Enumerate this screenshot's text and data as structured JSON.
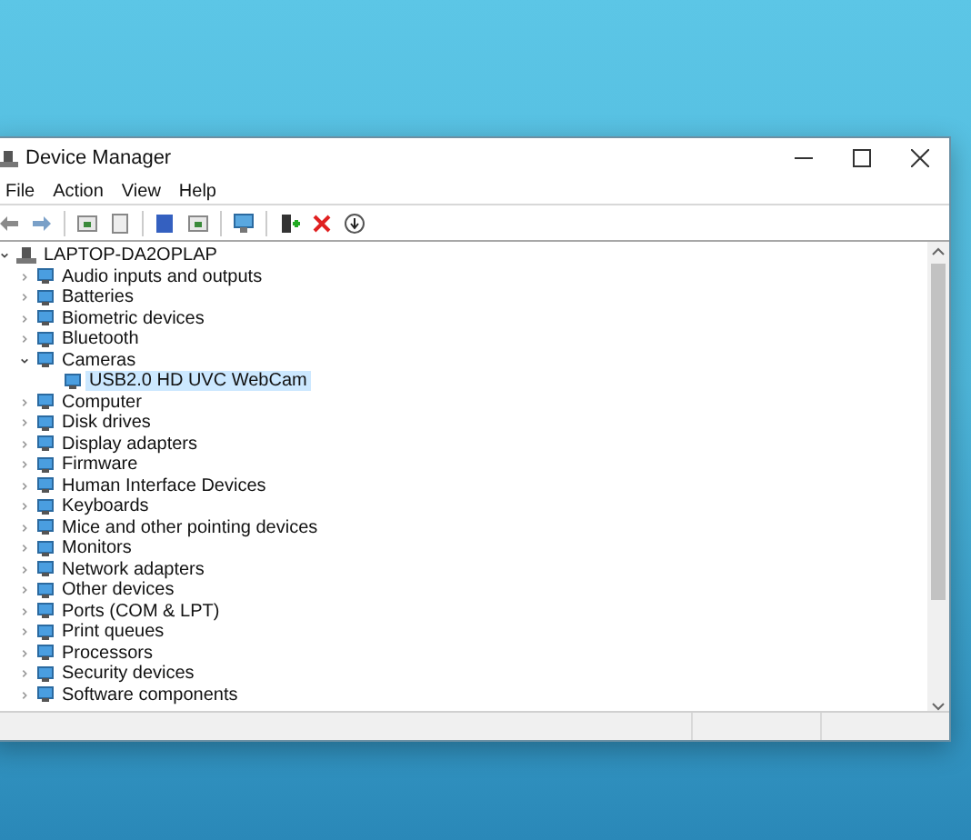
{
  "window": {
    "title": "Device Manager"
  },
  "menu": [
    "File",
    "Action",
    "View",
    "Help"
  ],
  "tree": {
    "label": "LAPTOP-DA2OPLAP",
    "expanded": true,
    "selected": false,
    "children": [
      {
        "label": "Audio inputs and outputs",
        "expanded": false,
        "selected": false
      },
      {
        "label": "Batteries",
        "expanded": false,
        "selected": false
      },
      {
        "label": "Biometric devices",
        "expanded": false,
        "selected": false
      },
      {
        "label": "Bluetooth",
        "expanded": false,
        "selected": false
      },
      {
        "label": "Cameras",
        "expanded": true,
        "selected": false,
        "children": [
          {
            "label": "USB2.0 HD UVC WebCam",
            "selected": true
          }
        ]
      },
      {
        "label": "Computer",
        "expanded": false,
        "selected": false
      },
      {
        "label": "Disk drives",
        "expanded": false,
        "selected": false
      },
      {
        "label": "Display adapters",
        "expanded": false,
        "selected": false
      },
      {
        "label": "Firmware",
        "expanded": false,
        "selected": false
      },
      {
        "label": "Human Interface Devices",
        "expanded": false,
        "selected": false
      },
      {
        "label": "Keyboards",
        "expanded": false,
        "selected": false
      },
      {
        "label": "Mice and other pointing devices",
        "expanded": false,
        "selected": false
      },
      {
        "label": "Monitors",
        "expanded": false,
        "selected": false
      },
      {
        "label": "Network adapters",
        "expanded": false,
        "selected": false
      },
      {
        "label": "Other devices",
        "expanded": false,
        "selected": false
      },
      {
        "label": "Ports (COM & LPT)",
        "expanded": false,
        "selected": false
      },
      {
        "label": "Print queues",
        "expanded": false,
        "selected": false
      },
      {
        "label": "Processors",
        "expanded": false,
        "selected": false
      },
      {
        "label": "Security devices",
        "expanded": false,
        "selected": false
      },
      {
        "label": "Software components",
        "expanded": false,
        "selected": false
      }
    ]
  }
}
